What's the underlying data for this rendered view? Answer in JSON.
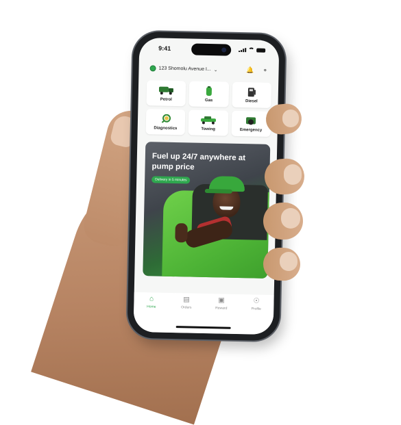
{
  "status": {
    "time": "9:41"
  },
  "location": {
    "address": "123 Shomolu Avenue I..."
  },
  "services": [
    {
      "label": "Petrol",
      "icon": "fuel-truck-icon"
    },
    {
      "label": "Gas",
      "icon": "gas-cylinder-icon"
    },
    {
      "label": "Diesel",
      "icon": "diesel-pump-icon"
    },
    {
      "label": "Diagnostics",
      "icon": "diagnostics-icon"
    },
    {
      "label": "Towing",
      "icon": "tow-truck-icon"
    },
    {
      "label": "Emergency",
      "icon": "emergency-icon"
    }
  ],
  "banner": {
    "title": "Fuel up 24/7 anywhere at pump price",
    "badge": "Delivery in 5 minutes"
  },
  "tabs": [
    {
      "label": "Home",
      "icon": "home-icon",
      "active": true
    },
    {
      "label": "Orders",
      "icon": "orders-icon",
      "active": false
    },
    {
      "label": "Reward",
      "icon": "gift-icon",
      "active": false
    },
    {
      "label": "Profile",
      "icon": "profile-icon",
      "active": false
    }
  ],
  "colors": {
    "brand": "#2fa84f",
    "background": "#f6f7f6"
  }
}
